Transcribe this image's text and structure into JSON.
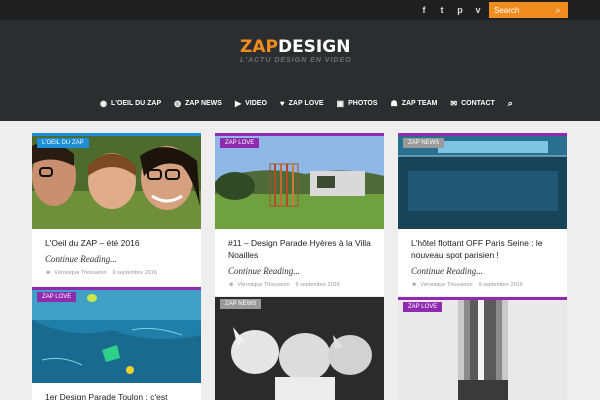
{
  "topbar": {
    "social": [
      {
        "icon": "facebook-icon",
        "glyph": "f"
      },
      {
        "icon": "twitter-icon",
        "glyph": "t"
      },
      {
        "icon": "pinterest-icon",
        "glyph": "p"
      },
      {
        "icon": "vimeo-icon",
        "glyph": "v"
      },
      {
        "icon": "instagram-icon",
        "glyph": "◙"
      }
    ],
    "search_placeholder": "Search"
  },
  "logo": {
    "zap": "ZAP",
    "design": "DESIGN",
    "tagline": "L'ACTU DESIGN EN VIDEO"
  },
  "nav": [
    {
      "label": "L'OEIL DU ZAP",
      "icon": "eye-icon",
      "glyph": "◉"
    },
    {
      "label": "ZAP NEWS",
      "icon": "globe-icon",
      "glyph": "◍"
    },
    {
      "label": "VIDEO",
      "icon": "video-icon",
      "glyph": "▶"
    },
    {
      "label": "ZAP LOVE",
      "icon": "heart-icon",
      "glyph": "♥"
    },
    {
      "label": "PHOTOS",
      "icon": "camera-icon",
      "glyph": "▣"
    },
    {
      "label": "ZAP TEAM",
      "icon": "team-icon",
      "glyph": "☗"
    },
    {
      "label": "CONTACT",
      "icon": "envelope-icon",
      "glyph": "✉"
    }
  ],
  "colors": {
    "accent": "#f08d1e",
    "purple": "#8f2bb0",
    "blue": "#1c8ed8",
    "grey": "#9a9a9a"
  },
  "cards": [
    {
      "category": "L'OEIL DU ZAP",
      "title": "L'Oeil du ZAP – été 2016",
      "more": "Continue Reading...",
      "author": "Véronique Thouvenin",
      "date": "9 septembre 2016"
    },
    {
      "category": "ZAP LOVE",
      "title": "#11 – Design Parade Hyères à la Villa Noailles",
      "more": "Continue Reading...",
      "author": "Véronique Thouvenin",
      "date": "9 septembre 2016"
    },
    {
      "category": "ZAP NEWS",
      "title": "L'hôtel flottant OFF Paris Seine : le nouveau spot parisien !",
      "more": "Continue Reading...",
      "author": "Véronique Thouvenin",
      "date": "9 septembre 2016"
    },
    {
      "category": "ZAP LOVE",
      "title": "1er Design Parade Toulon : c'est",
      "more": "",
      "author": "",
      "date": ""
    },
    {
      "category": "ZAP NEWS",
      "title": "",
      "more": "",
      "author": "",
      "date": ""
    },
    {
      "category": "ZAP LOVE",
      "title": "",
      "more": "",
      "author": "",
      "date": ""
    }
  ]
}
